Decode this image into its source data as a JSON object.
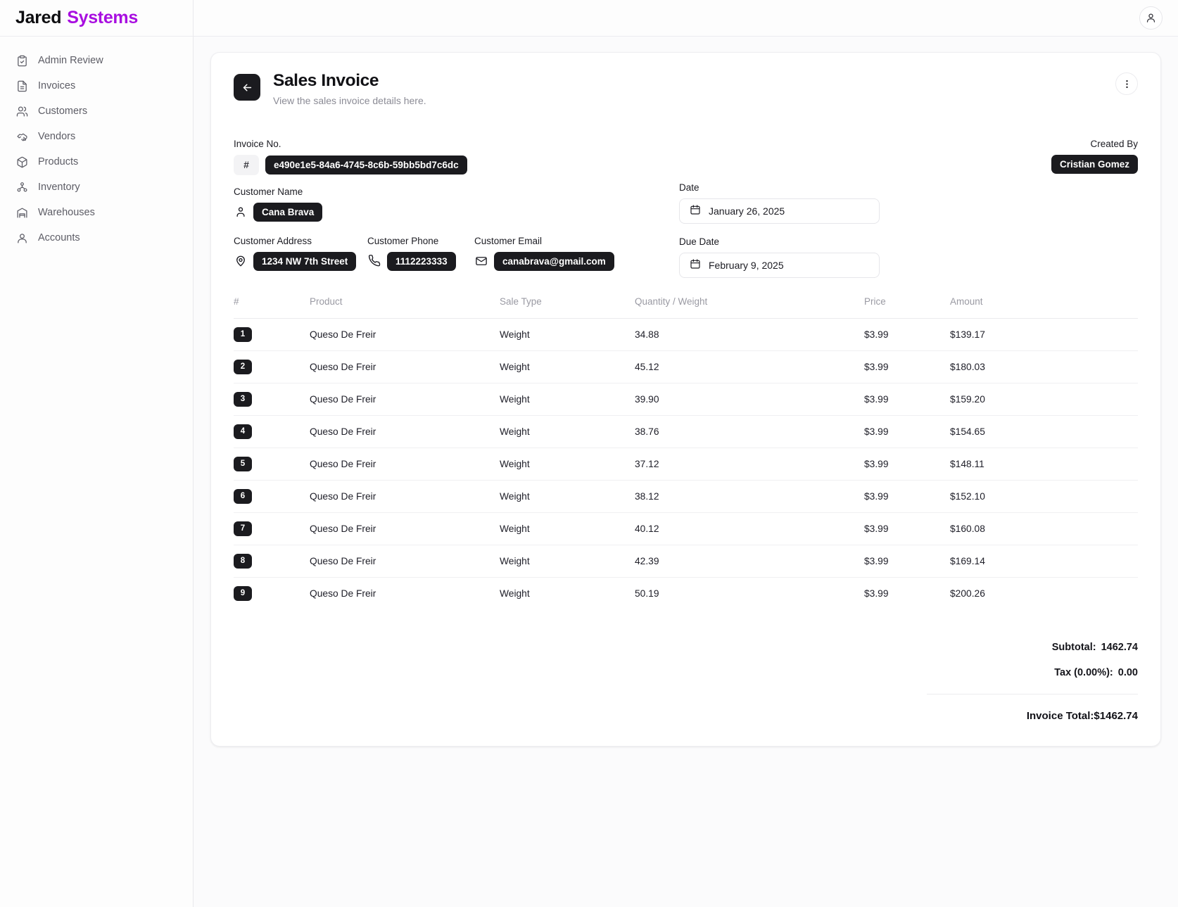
{
  "brand": {
    "part1": "Jared",
    "part2": "Systems"
  },
  "sidebar": {
    "items": [
      {
        "label": "Admin Review",
        "icon": "clipboard-check-icon"
      },
      {
        "label": "Invoices",
        "icon": "file-text-icon"
      },
      {
        "label": "Customers",
        "icon": "users-icon"
      },
      {
        "label": "Vendors",
        "icon": "handshake-icon"
      },
      {
        "label": "Products",
        "icon": "package-icon"
      },
      {
        "label": "Inventory",
        "icon": "boxes-icon"
      },
      {
        "label": "Warehouses",
        "icon": "warehouse-icon"
      },
      {
        "label": "Accounts",
        "icon": "user-circle-icon"
      }
    ]
  },
  "topbar": {
    "avatar_icon": "user-icon"
  },
  "page": {
    "title": "Sales Invoice",
    "subtitle": "View the sales invoice details here.",
    "back_icon": "arrow-left-icon",
    "menu_icon": "more-vertical-icon"
  },
  "fields": {
    "invoice_no_label": "Invoice No.",
    "invoice_no_prefix": "#",
    "invoice_no_value": "e490e1e5-84a6-4745-8c6b-59bb5bd7c6dc",
    "customer_name_label": "Customer Name",
    "customer_name_value": "Cana Brava",
    "customer_address_label": "Customer Address",
    "customer_address_value": "1234 NW 7th Street",
    "customer_phone_label": "Customer Phone",
    "customer_phone_value": "1112223333",
    "customer_email_label": "Customer Email",
    "customer_email_value": "canabrava@gmail.com",
    "date_label": "Date",
    "date_value": "January 26, 2025",
    "due_date_label": "Due Date",
    "due_date_value": "February 9, 2025",
    "created_by_label": "Created By",
    "created_by_value": "Cristian Gomez"
  },
  "table": {
    "columns": [
      "#",
      "Product",
      "Sale Type",
      "Quantity / Weight",
      "Price",
      "Amount"
    ],
    "rows": [
      {
        "idx": "1",
        "product": "Queso De Freir",
        "sale_type": "Weight",
        "quantity": "34.88",
        "price": "$3.99",
        "amount": "$139.17"
      },
      {
        "idx": "2",
        "product": "Queso De Freir",
        "sale_type": "Weight",
        "quantity": "45.12",
        "price": "$3.99",
        "amount": "$180.03"
      },
      {
        "idx": "3",
        "product": "Queso De Freir",
        "sale_type": "Weight",
        "quantity": "39.90",
        "price": "$3.99",
        "amount": "$159.20"
      },
      {
        "idx": "4",
        "product": "Queso De Freir",
        "sale_type": "Weight",
        "quantity": "38.76",
        "price": "$3.99",
        "amount": "$154.65"
      },
      {
        "idx": "5",
        "product": "Queso De Freir",
        "sale_type": "Weight",
        "quantity": "37.12",
        "price": "$3.99",
        "amount": "$148.11"
      },
      {
        "idx": "6",
        "product": "Queso De Freir",
        "sale_type": "Weight",
        "quantity": "38.12",
        "price": "$3.99",
        "amount": "$152.10"
      },
      {
        "idx": "7",
        "product": "Queso De Freir",
        "sale_type": "Weight",
        "quantity": "40.12",
        "price": "$3.99",
        "amount": "$160.08"
      },
      {
        "idx": "8",
        "product": "Queso De Freir",
        "sale_type": "Weight",
        "quantity": "42.39",
        "price": "$3.99",
        "amount": "$169.14"
      },
      {
        "idx": "9",
        "product": "Queso De Freir",
        "sale_type": "Weight",
        "quantity": "50.19",
        "price": "$3.99",
        "amount": "$200.26"
      }
    ]
  },
  "totals": {
    "subtotal_label": "Subtotal:",
    "subtotal_value": "1462.74",
    "tax_label": "Tax (0.00%):",
    "tax_value": "0.00",
    "grand_label": "Invoice Total:",
    "grand_value": "$1462.74"
  },
  "colors": {
    "brand_accent": "#a80ee0",
    "chip_bg": "#1b1b1f",
    "page_bg": "#fbfbfc",
    "muted_text": "#8b8b95"
  }
}
